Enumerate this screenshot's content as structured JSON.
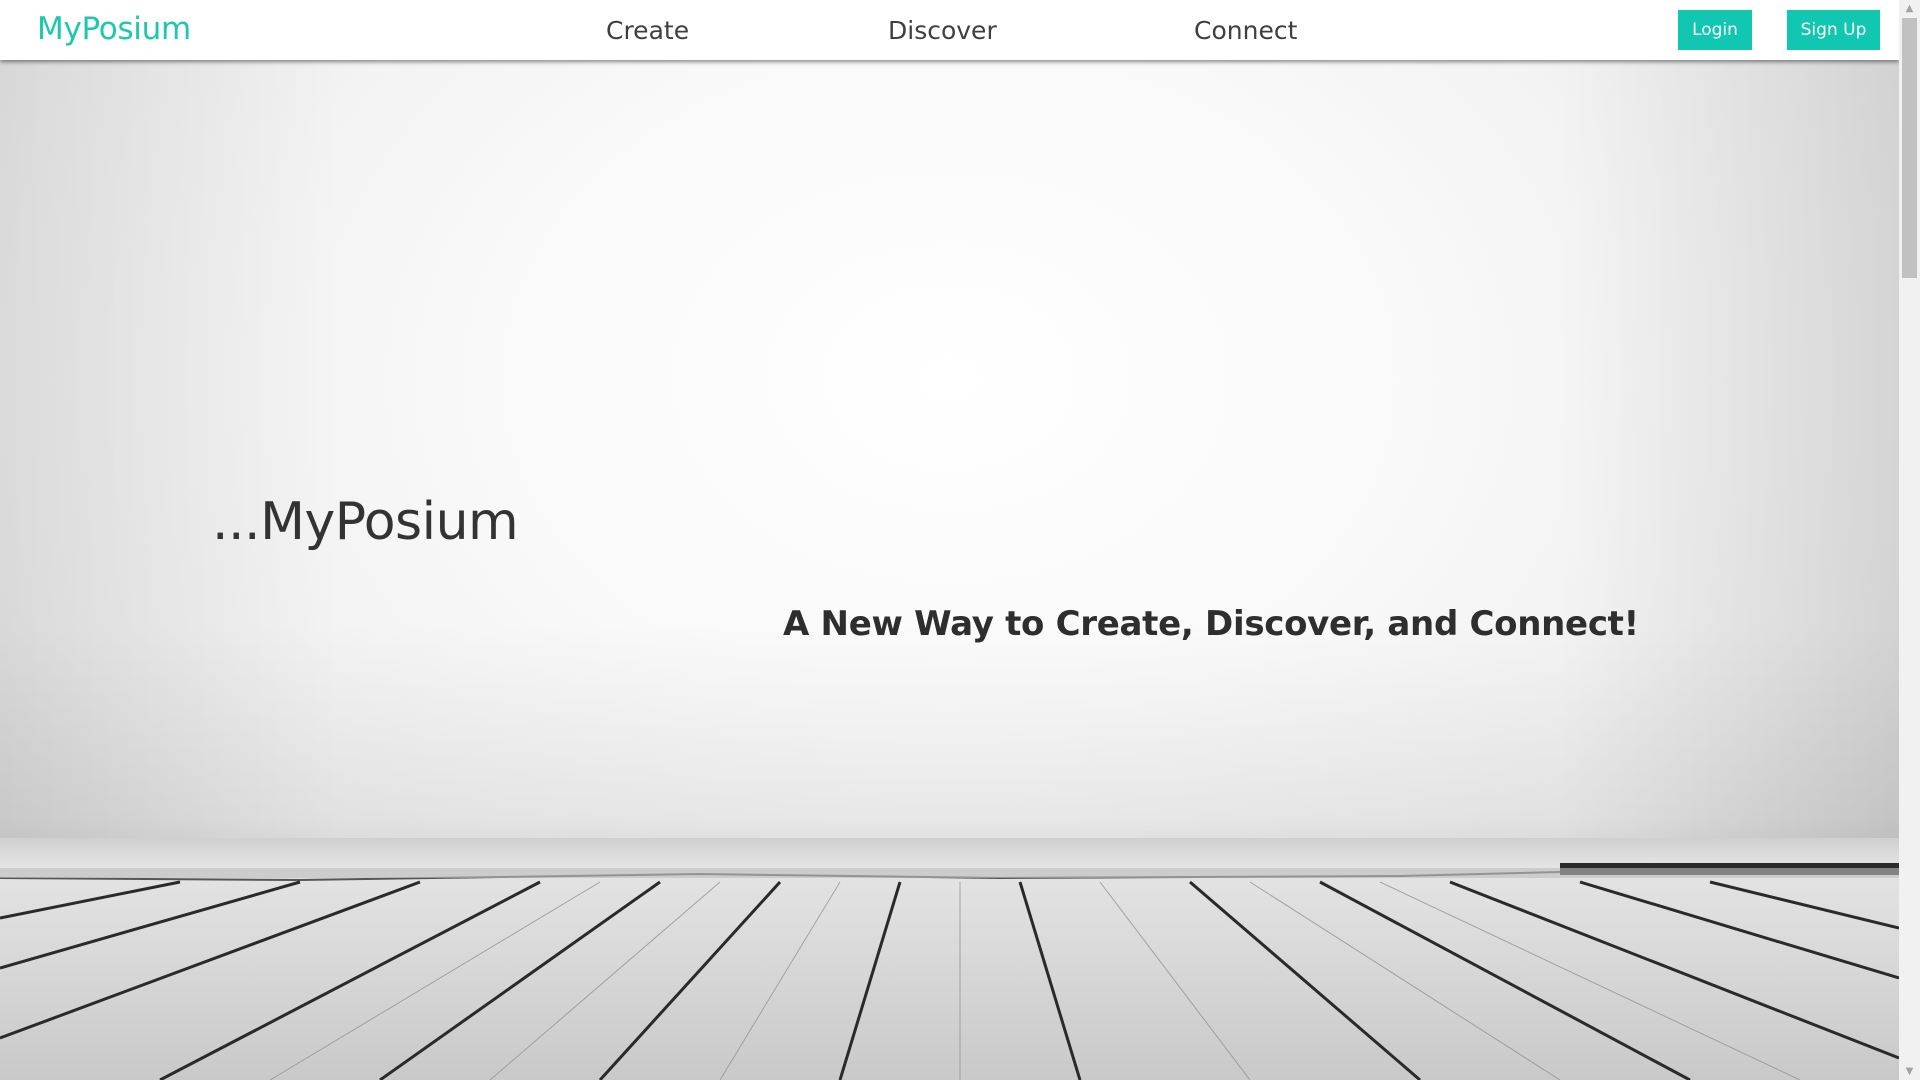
{
  "nav": {
    "brand": "MyPosium",
    "links": [
      "Create",
      "Discover",
      "Connect"
    ],
    "login_label": "Login",
    "signup_label": "Sign Up"
  },
  "hero": {
    "title": "...MyPosium",
    "tagline": "A New Way to Create, Discover, and Connect!"
  },
  "colors": {
    "accent": "#12c7b1",
    "brand_text": "#1dc7b0",
    "nav_text": "#3f3f3f"
  },
  "icons": {
    "scroll_up": "triangle-up",
    "scroll_down": "triangle-down"
  }
}
